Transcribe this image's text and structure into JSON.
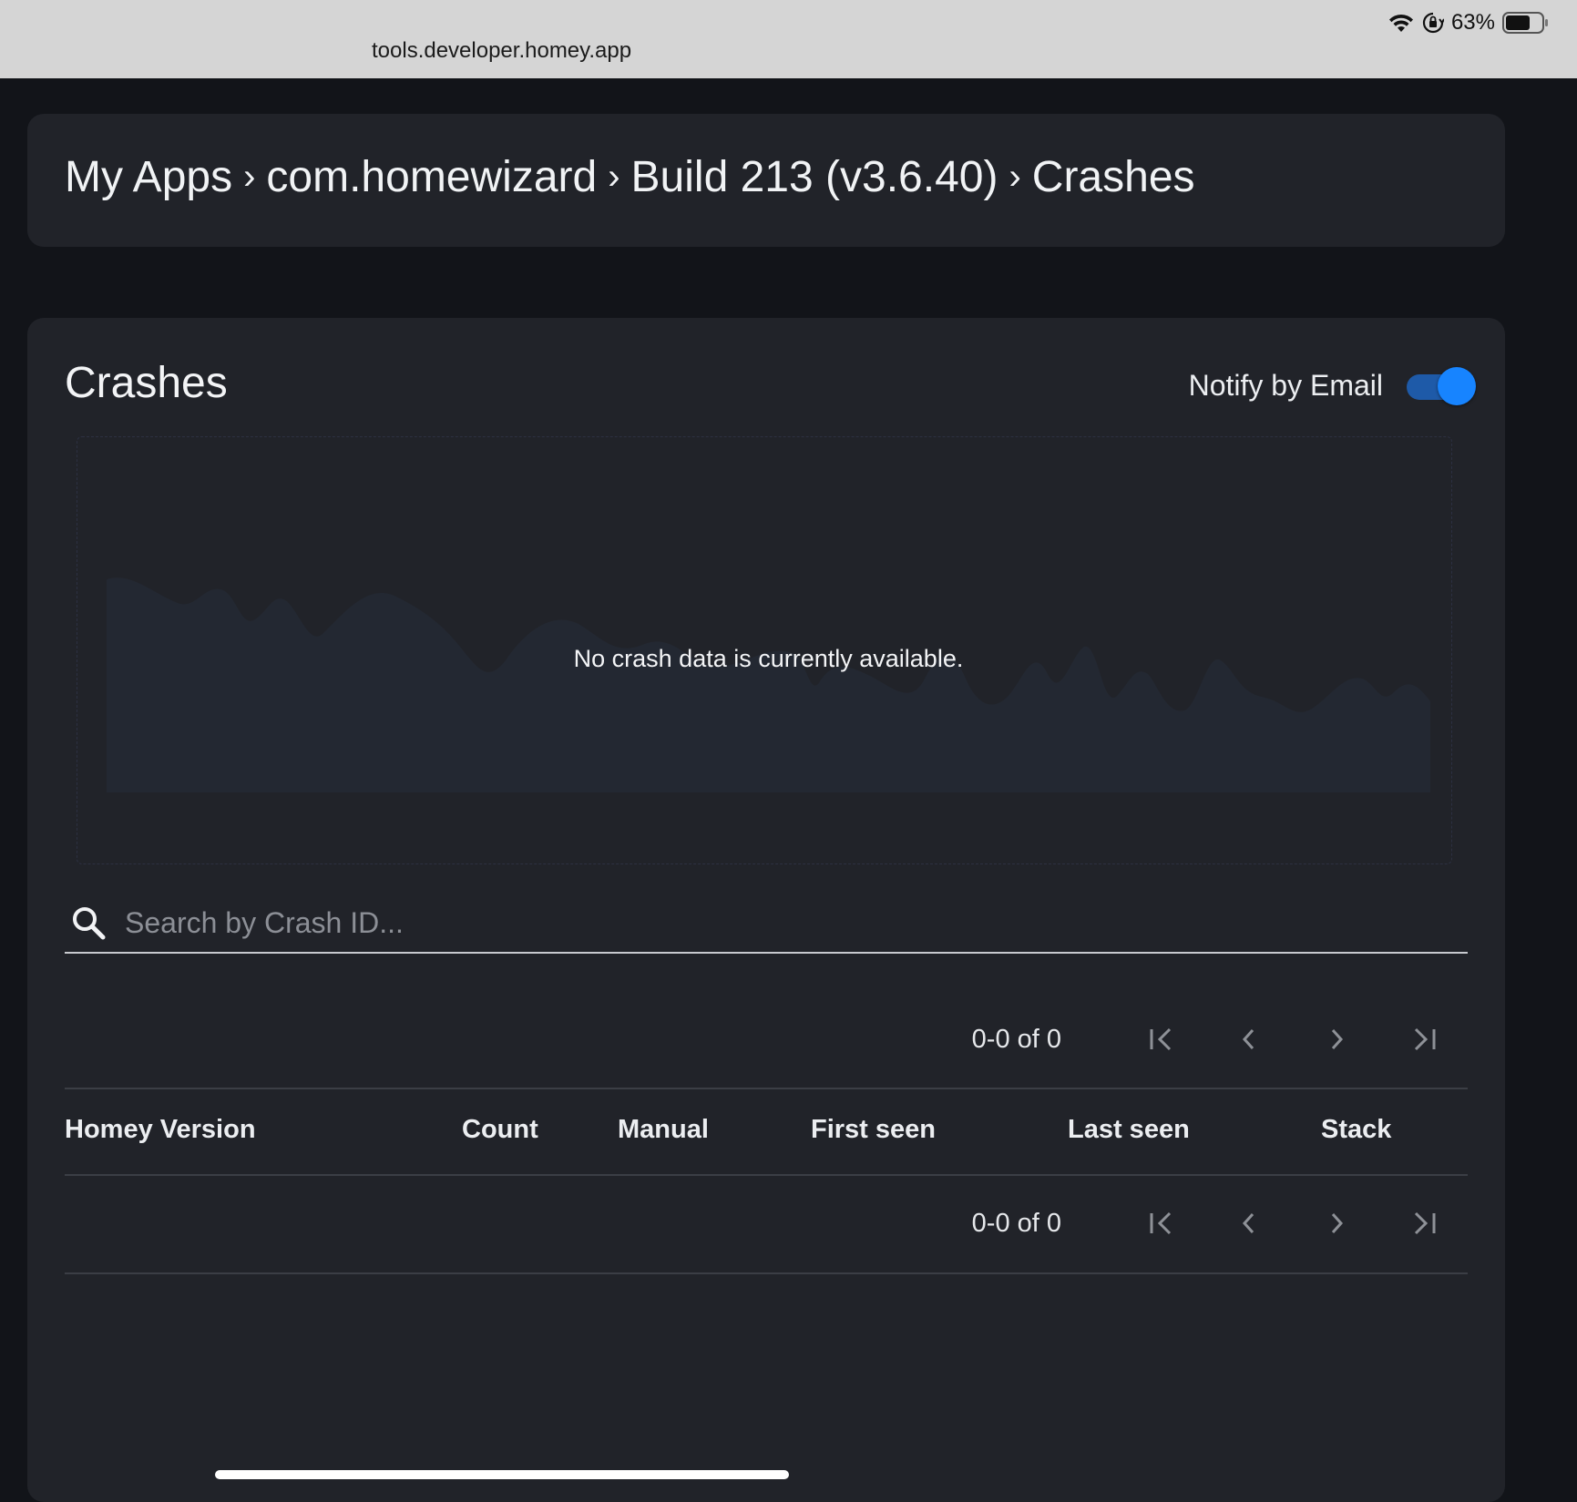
{
  "browser": {
    "url": "tools.developer.homey.app",
    "battery": "63%"
  },
  "breadcrumb": {
    "items": [
      "My Apps",
      "com.homewizard",
      "Build 213 (v3.6.40)",
      "Crashes"
    ],
    "separator": "›"
  },
  "crashes": {
    "title": "Crashes",
    "notify_label": "Notify by Email",
    "notify_enabled": true,
    "chart_message": "No crash data is currently available.",
    "search_placeholder": "Search by Crash ID...",
    "pagination_label": "0-0 of 0",
    "columns": [
      "Homey Version",
      "Count",
      "Manual",
      "First seen",
      "Last seen",
      "Stack"
    ]
  },
  "colors": {
    "background": "#121419",
    "card": "#212329",
    "accent": "#1784ff",
    "toggle_track": "#1e5aa8"
  }
}
